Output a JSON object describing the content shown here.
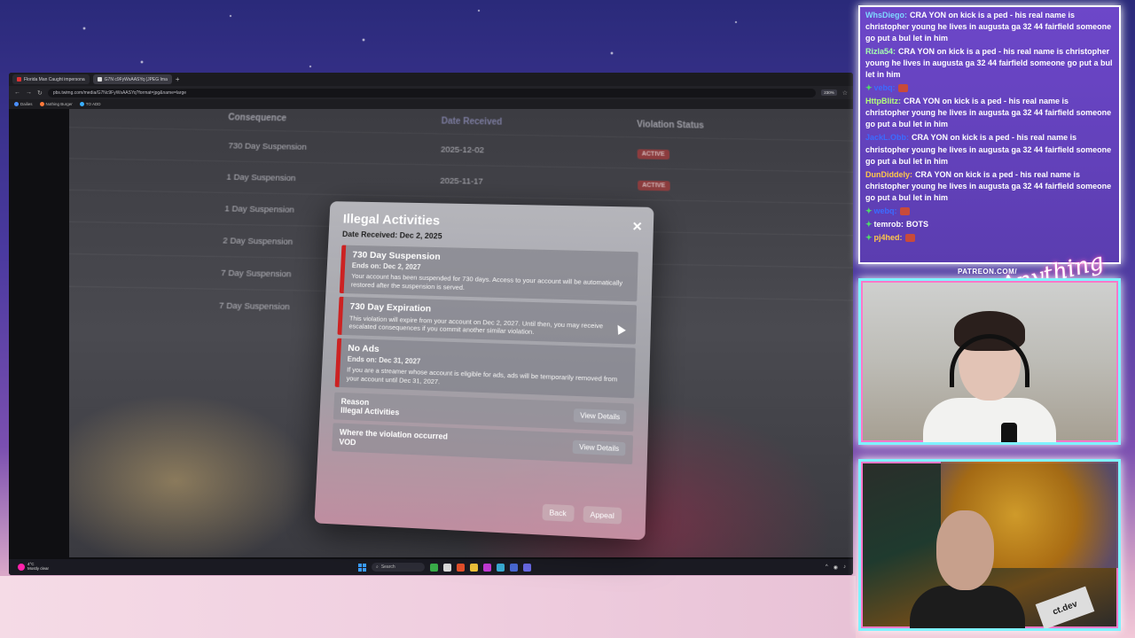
{
  "browser": {
    "tabs": [
      {
        "label": "Florida Man Caught impersona"
      },
      {
        "label": "G7N c9FyWsAASYq (JPEG Ima"
      }
    ],
    "url": "pbs.twimg.com/media/G7Nc9FyWsAASYq?format=jpg&name=large",
    "zoom": "230%",
    "bookmarks": [
      "Dailies",
      "Nothing Burger",
      "TO ADD"
    ]
  },
  "table": {
    "headers": [
      "Consequence",
      "Date Received",
      "Violation Status"
    ],
    "rows": [
      {
        "consequence": "730 Day Suspension",
        "date": "2025-12-02",
        "status": "ACTIVE"
      },
      {
        "consequence": "1 Day Suspension",
        "date": "2025-11-17",
        "status": "ACTIVE"
      },
      {
        "consequence": "1 Day Suspension",
        "date": "",
        "status": ""
      },
      {
        "consequence": "2 Day Suspension",
        "date": "",
        "status": ""
      },
      {
        "consequence": "7 Day Suspension",
        "date": "",
        "status": ""
      },
      {
        "consequence": "7 Day Suspension",
        "date": "",
        "status": ""
      }
    ]
  },
  "modal": {
    "title": "Illegal Activities",
    "date_received": "Date Received: Dec 2, 2025",
    "violations": [
      {
        "title": "730 Day Suspension",
        "sub": "Ends on: Dec 2, 2027",
        "body": "Your account has been suspended for 730 days. Access to your account will be automatically restored after the suspension is served."
      },
      {
        "title": "730 Day Expiration",
        "sub": "",
        "body": "This violation will expire from your account on Dec 2, 2027. Until then, you may receive escalated consequences if you commit another similar violation."
      },
      {
        "title": "No Ads",
        "sub": "Ends on: Dec 31, 2027",
        "body": "If you are a streamer whose account is eligible for ads, ads will be temporarily removed from your account until Dec 31, 2027."
      }
    ],
    "reason_label": "Reason",
    "reason_value": "Illegal Activities",
    "where_label": "Where the violation occurred",
    "where_value": "VOD",
    "view_details": "View Details",
    "back": "Back",
    "appeal": "Appeal"
  },
  "taskbar": {
    "temp": "4°C",
    "weather": "Mostly clear",
    "search": "Search"
  },
  "chat": {
    "messages": [
      {
        "user": "WhsDiego:",
        "user_color": "#7fd8ff",
        "text": "CRA YON on kick is a ped - his real name is christopher young he lives in augusta ga 32 44 fairfield someone go put a bul let in him"
      },
      {
        "user": "Rizla54:",
        "user_color": "#a6ffb0",
        "text": "CRA YON on kick is a ped - his real name is christopher young he lives in augusta ga 32 44 fairfield someone go put a bul let in him"
      },
      {
        "user": "vebq:",
        "user_color": "#3b6bff",
        "text": ""
      },
      {
        "user": "HttpBlitz:",
        "user_color": "#b5ff7a",
        "text": "CRA YON on kick is a ped - his real name is christopher young he lives in augusta ga 32 44 fairfield someone go put a bul let in him"
      },
      {
        "user": "JackL.Obb:",
        "user_color": "#3b6bff",
        "text": "CRA YON on kick is a ped - his real name is christopher young he lives in augusta ga 32 44 fairfield someone go put a bul let in him"
      },
      {
        "user": "DunDiddely:",
        "user_color": "#ffc84a",
        "text": "CRA YON on kick is a ped - his real name is christopher young he lives in augusta ga 32 44 fairfield someone go put a bul let in him"
      },
      {
        "user": "webq:",
        "user_color": "#3b6bff",
        "text": ""
      },
      {
        "user": "temrob:",
        "user_color": "#ffffff",
        "text": "BOTS"
      },
      {
        "user": "pj4hed:",
        "user_color": "#ffc84a",
        "text": ""
      }
    ]
  },
  "overlay": {
    "patreon": "PATREON.COM/",
    "brand": "Anything Else?",
    "cam2_mic": "ct.dev"
  }
}
